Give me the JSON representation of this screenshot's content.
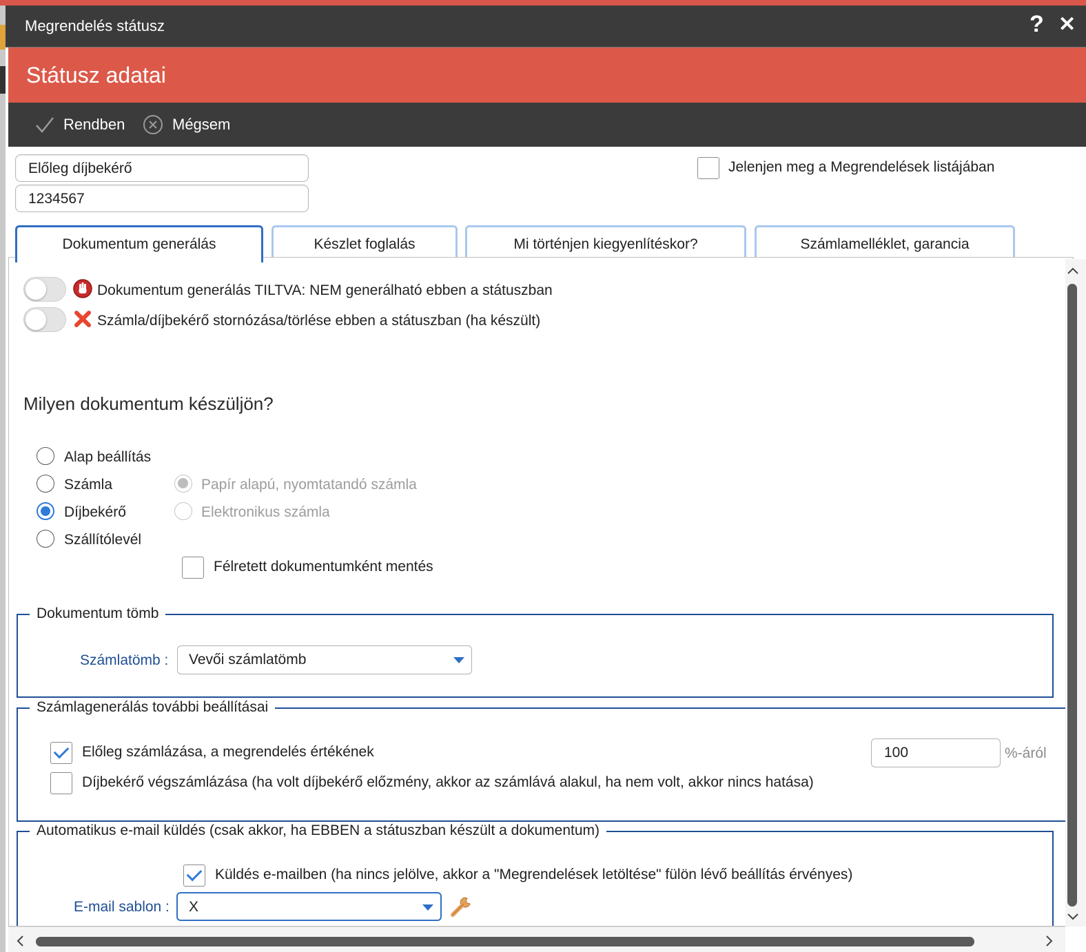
{
  "window": {
    "title": "Megrendelés státusz",
    "help_label": "?",
    "close_label": "✕"
  },
  "header": {
    "title": "Státusz adatai"
  },
  "toolbar": {
    "ok_label": "Rendben",
    "cancel_label": "Mégsem"
  },
  "fields": {
    "name_value": "Előleg díjbekérő",
    "code_value": "1234567"
  },
  "show_in_list": {
    "label": "Jelenjen meg a Megrendelések listájában",
    "checked": false
  },
  "tabs": [
    {
      "label": "Dokumentum generálás",
      "active": true
    },
    {
      "label": "Készlet foglalás",
      "active": false
    },
    {
      "label": "Mi történjen kiegyenlítéskor?",
      "active": false
    },
    {
      "label": "Számlamelléklet, garancia",
      "active": false
    }
  ],
  "toggles": [
    {
      "label": "Dokumentum generálás TILTVA: NEM generálható ebben a státuszban",
      "icon": "stop-hand-icon",
      "on": false
    },
    {
      "label": "Számla/díjbekérő stornózása/törlése ebben a státuszban (ha készült)",
      "icon": "red-x-icon",
      "on": false
    }
  ],
  "doc_type": {
    "heading": "Milyen dokumentum készüljön?",
    "options": [
      {
        "label": "Alap beállítás",
        "checked": false
      },
      {
        "label": "Számla",
        "checked": false
      },
      {
        "label": "Díjbekérő",
        "checked": true
      },
      {
        "label": "Szállítólevél",
        "checked": false
      }
    ],
    "sub_options": [
      {
        "label": "Papír alapú, nyomtatandó számla",
        "checked": true,
        "disabled": true
      },
      {
        "label": "Elektronikus számla",
        "checked": false,
        "disabled": true
      }
    ],
    "draft_label": "Félretett dokumentumként mentés",
    "draft_checked": false
  },
  "doc_block": {
    "legend": "Dokumentum tömb",
    "field_label": "Számlatömb :",
    "selected": "Vevői számlatömb"
  },
  "invoice_settings": {
    "legend": "Számlagenerálás további beállításai",
    "advance": {
      "label": "Előleg számlázása, a megrendelés értékének",
      "checked": true,
      "value": "100",
      "suffix": "%-áról"
    },
    "final": {
      "label": "Díjbekérő végszámlázása (ha volt díjbekérő előzmény, akkor az számlává alakul, ha nem volt, akkor nincs hatása)",
      "checked": false
    }
  },
  "email": {
    "legend": "Automatikus e-mail küldés (csak akkor, ha EBBEN a státuszban készült a dokumentum)",
    "send": {
      "label": "Küldés e-mailben (ha nincs jelölve, akkor a \"Megrendelések letöltése\" fülön lévő beállítás érvényes)",
      "checked": true
    },
    "template_label": "E-mail sablon :",
    "template_selected": "X",
    "settings_icon": "wrench-icon"
  },
  "colors": {
    "accent_red": "#dc5949",
    "dark_bar": "#3b3b3b",
    "tab_blue": "#2f6fc4",
    "fieldset_blue": "#1f4f94",
    "check_blue": "#2f7bd9"
  }
}
